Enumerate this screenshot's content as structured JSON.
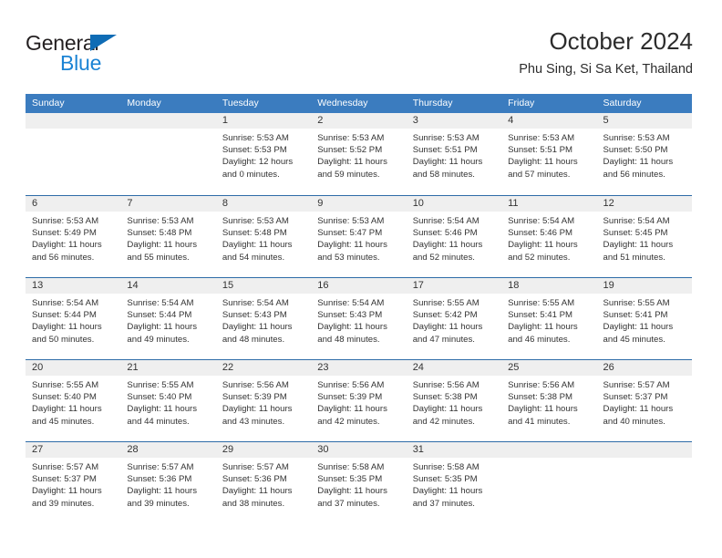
{
  "logo": {
    "primary_text": "General",
    "secondary_text": "Blue",
    "primary_color": "#231f20",
    "secondary_color": "#1b83d4",
    "triangle_color": "#0f6cb5"
  },
  "header": {
    "title": "October 2024",
    "subtitle": "Phu Sing, Si Sa Ket, Thailand"
  },
  "theme": {
    "header_bar_color": "#3b7cbf",
    "row_divider_color": "#2e6ca8",
    "date_band_color": "#efefef",
    "text_color": "#333333"
  },
  "weekdays": [
    "Sunday",
    "Monday",
    "Tuesday",
    "Wednesday",
    "Thursday",
    "Friday",
    "Saturday"
  ],
  "weeks": [
    [
      {
        "day": "",
        "sunrise": "",
        "sunset": "",
        "daylight_1": "",
        "daylight_2": ""
      },
      {
        "day": "",
        "sunrise": "",
        "sunset": "",
        "daylight_1": "",
        "daylight_2": ""
      },
      {
        "day": "1",
        "sunrise": "Sunrise: 5:53 AM",
        "sunset": "Sunset: 5:53 PM",
        "daylight_1": "Daylight: 12 hours",
        "daylight_2": "and 0 minutes."
      },
      {
        "day": "2",
        "sunrise": "Sunrise: 5:53 AM",
        "sunset": "Sunset: 5:52 PM",
        "daylight_1": "Daylight: 11 hours",
        "daylight_2": "and 59 minutes."
      },
      {
        "day": "3",
        "sunrise": "Sunrise: 5:53 AM",
        "sunset": "Sunset: 5:51 PM",
        "daylight_1": "Daylight: 11 hours",
        "daylight_2": "and 58 minutes."
      },
      {
        "day": "4",
        "sunrise": "Sunrise: 5:53 AM",
        "sunset": "Sunset: 5:51 PM",
        "daylight_1": "Daylight: 11 hours",
        "daylight_2": "and 57 minutes."
      },
      {
        "day": "5",
        "sunrise": "Sunrise: 5:53 AM",
        "sunset": "Sunset: 5:50 PM",
        "daylight_1": "Daylight: 11 hours",
        "daylight_2": "and 56 minutes."
      }
    ],
    [
      {
        "day": "6",
        "sunrise": "Sunrise: 5:53 AM",
        "sunset": "Sunset: 5:49 PM",
        "daylight_1": "Daylight: 11 hours",
        "daylight_2": "and 56 minutes."
      },
      {
        "day": "7",
        "sunrise": "Sunrise: 5:53 AM",
        "sunset": "Sunset: 5:48 PM",
        "daylight_1": "Daylight: 11 hours",
        "daylight_2": "and 55 minutes."
      },
      {
        "day": "8",
        "sunrise": "Sunrise: 5:53 AM",
        "sunset": "Sunset: 5:48 PM",
        "daylight_1": "Daylight: 11 hours",
        "daylight_2": "and 54 minutes."
      },
      {
        "day": "9",
        "sunrise": "Sunrise: 5:53 AM",
        "sunset": "Sunset: 5:47 PM",
        "daylight_1": "Daylight: 11 hours",
        "daylight_2": "and 53 minutes."
      },
      {
        "day": "10",
        "sunrise": "Sunrise: 5:54 AM",
        "sunset": "Sunset: 5:46 PM",
        "daylight_1": "Daylight: 11 hours",
        "daylight_2": "and 52 minutes."
      },
      {
        "day": "11",
        "sunrise": "Sunrise: 5:54 AM",
        "sunset": "Sunset: 5:46 PM",
        "daylight_1": "Daylight: 11 hours",
        "daylight_2": "and 52 minutes."
      },
      {
        "day": "12",
        "sunrise": "Sunrise: 5:54 AM",
        "sunset": "Sunset: 5:45 PM",
        "daylight_1": "Daylight: 11 hours",
        "daylight_2": "and 51 minutes."
      }
    ],
    [
      {
        "day": "13",
        "sunrise": "Sunrise: 5:54 AM",
        "sunset": "Sunset: 5:44 PM",
        "daylight_1": "Daylight: 11 hours",
        "daylight_2": "and 50 minutes."
      },
      {
        "day": "14",
        "sunrise": "Sunrise: 5:54 AM",
        "sunset": "Sunset: 5:44 PM",
        "daylight_1": "Daylight: 11 hours",
        "daylight_2": "and 49 minutes."
      },
      {
        "day": "15",
        "sunrise": "Sunrise: 5:54 AM",
        "sunset": "Sunset: 5:43 PM",
        "daylight_1": "Daylight: 11 hours",
        "daylight_2": "and 48 minutes."
      },
      {
        "day": "16",
        "sunrise": "Sunrise: 5:54 AM",
        "sunset": "Sunset: 5:43 PM",
        "daylight_1": "Daylight: 11 hours",
        "daylight_2": "and 48 minutes."
      },
      {
        "day": "17",
        "sunrise": "Sunrise: 5:55 AM",
        "sunset": "Sunset: 5:42 PM",
        "daylight_1": "Daylight: 11 hours",
        "daylight_2": "and 47 minutes."
      },
      {
        "day": "18",
        "sunrise": "Sunrise: 5:55 AM",
        "sunset": "Sunset: 5:41 PM",
        "daylight_1": "Daylight: 11 hours",
        "daylight_2": "and 46 minutes."
      },
      {
        "day": "19",
        "sunrise": "Sunrise: 5:55 AM",
        "sunset": "Sunset: 5:41 PM",
        "daylight_1": "Daylight: 11 hours",
        "daylight_2": "and 45 minutes."
      }
    ],
    [
      {
        "day": "20",
        "sunrise": "Sunrise: 5:55 AM",
        "sunset": "Sunset: 5:40 PM",
        "daylight_1": "Daylight: 11 hours",
        "daylight_2": "and 45 minutes."
      },
      {
        "day": "21",
        "sunrise": "Sunrise: 5:55 AM",
        "sunset": "Sunset: 5:40 PM",
        "daylight_1": "Daylight: 11 hours",
        "daylight_2": "and 44 minutes."
      },
      {
        "day": "22",
        "sunrise": "Sunrise: 5:56 AM",
        "sunset": "Sunset: 5:39 PM",
        "daylight_1": "Daylight: 11 hours",
        "daylight_2": "and 43 minutes."
      },
      {
        "day": "23",
        "sunrise": "Sunrise: 5:56 AM",
        "sunset": "Sunset: 5:39 PM",
        "daylight_1": "Daylight: 11 hours",
        "daylight_2": "and 42 minutes."
      },
      {
        "day": "24",
        "sunrise": "Sunrise: 5:56 AM",
        "sunset": "Sunset: 5:38 PM",
        "daylight_1": "Daylight: 11 hours",
        "daylight_2": "and 42 minutes."
      },
      {
        "day": "25",
        "sunrise": "Sunrise: 5:56 AM",
        "sunset": "Sunset: 5:38 PM",
        "daylight_1": "Daylight: 11 hours",
        "daylight_2": "and 41 minutes."
      },
      {
        "day": "26",
        "sunrise": "Sunrise: 5:57 AM",
        "sunset": "Sunset: 5:37 PM",
        "daylight_1": "Daylight: 11 hours",
        "daylight_2": "and 40 minutes."
      }
    ],
    [
      {
        "day": "27",
        "sunrise": "Sunrise: 5:57 AM",
        "sunset": "Sunset: 5:37 PM",
        "daylight_1": "Daylight: 11 hours",
        "daylight_2": "and 39 minutes."
      },
      {
        "day": "28",
        "sunrise": "Sunrise: 5:57 AM",
        "sunset": "Sunset: 5:36 PM",
        "daylight_1": "Daylight: 11 hours",
        "daylight_2": "and 39 minutes."
      },
      {
        "day": "29",
        "sunrise": "Sunrise: 5:57 AM",
        "sunset": "Sunset: 5:36 PM",
        "daylight_1": "Daylight: 11 hours",
        "daylight_2": "and 38 minutes."
      },
      {
        "day": "30",
        "sunrise": "Sunrise: 5:58 AM",
        "sunset": "Sunset: 5:35 PM",
        "daylight_1": "Daylight: 11 hours",
        "daylight_2": "and 37 minutes."
      },
      {
        "day": "31",
        "sunrise": "Sunrise: 5:58 AM",
        "sunset": "Sunset: 5:35 PM",
        "daylight_1": "Daylight: 11 hours",
        "daylight_2": "and 37 minutes."
      },
      {
        "day": "",
        "sunrise": "",
        "sunset": "",
        "daylight_1": "",
        "daylight_2": ""
      },
      {
        "day": "",
        "sunrise": "",
        "sunset": "",
        "daylight_1": "",
        "daylight_2": ""
      }
    ]
  ]
}
